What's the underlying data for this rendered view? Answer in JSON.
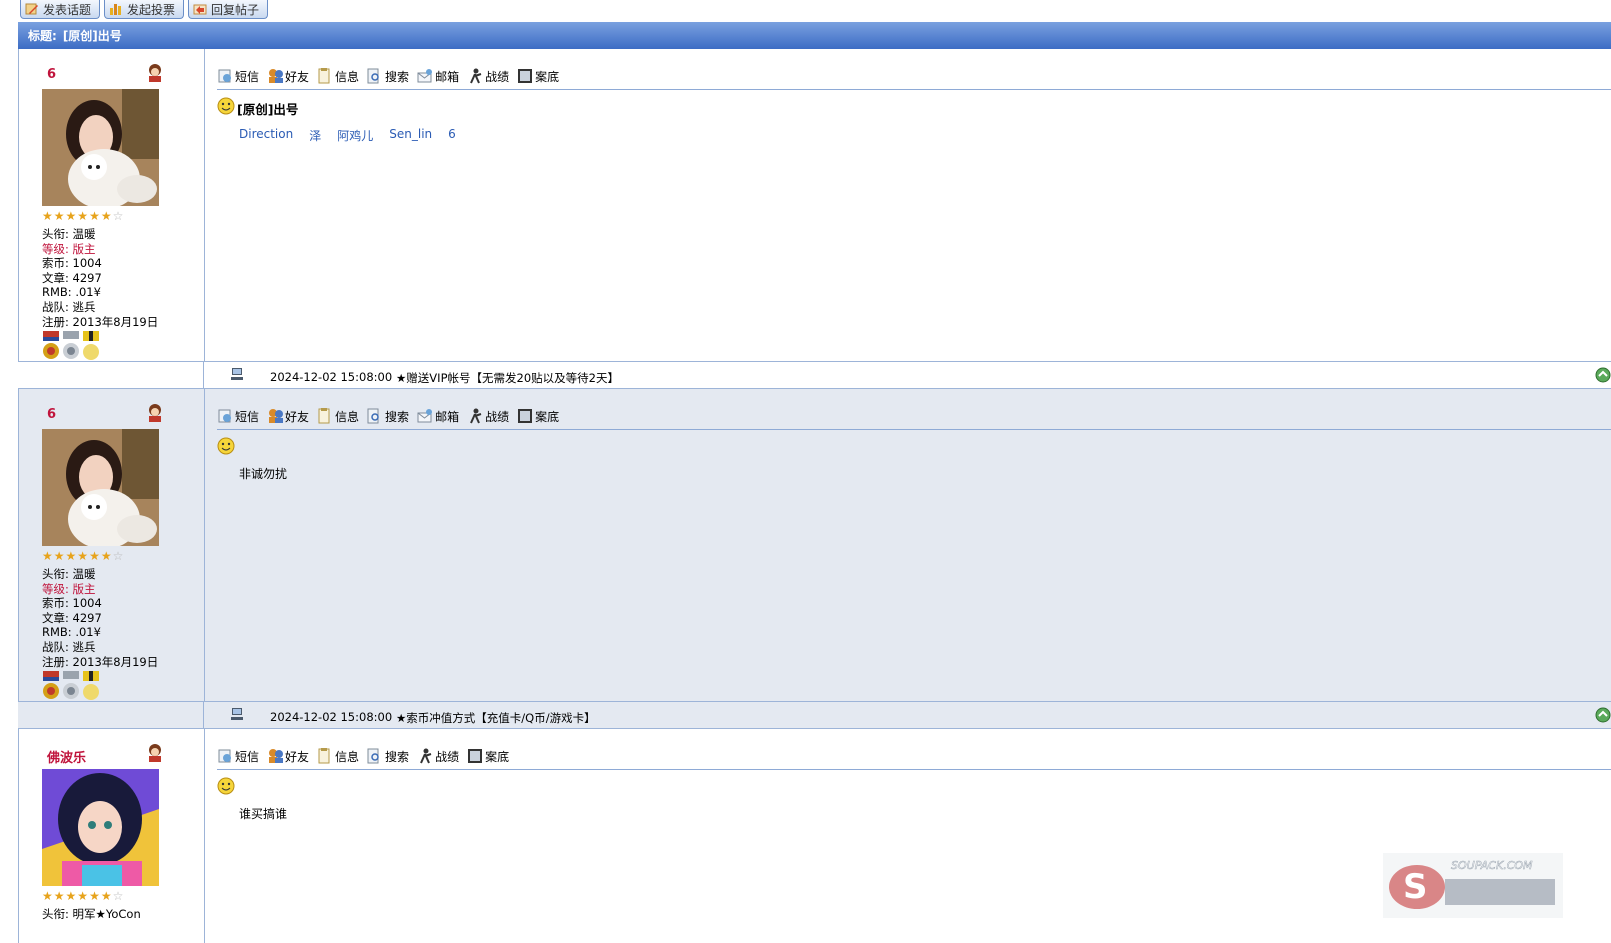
{
  "top_buttons": [
    {
      "label": "发表话题",
      "icon": "pencil-icon"
    },
    {
      "label": "发起投票",
      "icon": "chart-icon"
    },
    {
      "label": "回复帖子",
      "icon": "reply-icon"
    }
  ],
  "thread": {
    "title_label": "标题:",
    "title": "[原创]出号"
  },
  "toolbar_items": [
    "短信",
    "好友",
    "信息",
    "搜索",
    "邮箱",
    "战绩",
    "案底"
  ],
  "toolbar_items_short": [
    "短信",
    "好友",
    "信息",
    "搜索",
    "战绩",
    "案底"
  ],
  "colors": {
    "title_bar": "#4f7fd0",
    "alt_bg": "#e4e9f1",
    "username": "#c0143c",
    "link": "#2a5bb4"
  },
  "posts": [
    {
      "username": "6",
      "stars": 6,
      "stars_total": 7,
      "info": {
        "title": "头衔: 温暖",
        "level": "等级: 版主",
        "coins": "索币: 1004",
        "posts": "文章: 4297",
        "rmb": "RMB: .01¥",
        "team": "战队: 逃兵",
        "reg": "注册: 2013年8月19日"
      },
      "post_title": "[原创]出号",
      "links": [
        "Direction",
        "泽",
        "阿鸡儿",
        "Sen_lin",
        "6"
      ],
      "date": "2024-12-02 15:08:00",
      "note": "★赠送VIP帐号【无需发20贴以及等待2天】"
    },
    {
      "username": "6",
      "stars": 6,
      "stars_total": 7,
      "info": {
        "title": "头衔: 温暖",
        "level": "等级: 版主",
        "coins": "索币: 1004",
        "posts": "文章: 4297",
        "rmb": "RMB: .01¥",
        "team": "战队: 逃兵",
        "reg": "注册: 2013年8月19日"
      },
      "body": "非诚勿扰",
      "date": "2024-12-02 15:08:00",
      "note": "★索币冲值方式【充值卡/Q币/游戏卡】"
    },
    {
      "username": "佛波乐",
      "stars": 6,
      "stars_total": 7,
      "info": {
        "title": "头衔: 明军★YoCon"
      },
      "body": "谁买搞谁"
    }
  ],
  "watermark": "SOUPACK.COM"
}
